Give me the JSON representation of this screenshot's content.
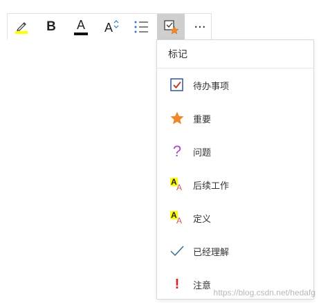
{
  "toolbar": {
    "buttons": [
      {
        "name": "highlight-icon"
      },
      {
        "name": "bold-icon",
        "label": "B"
      },
      {
        "name": "font-color-icon",
        "label": "A"
      },
      {
        "name": "font-size-icon",
        "label": "A"
      },
      {
        "name": "bullet-list-icon"
      },
      {
        "name": "tag-icon",
        "active": true
      },
      {
        "name": "more-icon",
        "label": "···"
      }
    ]
  },
  "menu": {
    "title": "标记",
    "items": [
      {
        "label": "待办事项",
        "icon": "checkbox-icon"
      },
      {
        "label": "重要",
        "icon": "star-icon"
      },
      {
        "label": "问题",
        "icon": "question-icon"
      },
      {
        "label": "后续工作",
        "icon": "highlight-text-icon"
      },
      {
        "label": "定义",
        "icon": "highlight-text-icon"
      },
      {
        "label": "已经理解",
        "icon": "checkmark-icon"
      },
      {
        "label": "注意",
        "icon": "exclamation-icon"
      }
    ]
  },
  "watermark": "https://blog.csdn.net/hedafg",
  "colors": {
    "highlight_yellow": "#ffff00",
    "star_orange": "#f0882a",
    "check_blue": "#2b5797",
    "check_red": "#c0392b",
    "question_purple": "#a64ac9",
    "exclamation_red": "#e02020",
    "text_a_red": "#d9534f"
  }
}
